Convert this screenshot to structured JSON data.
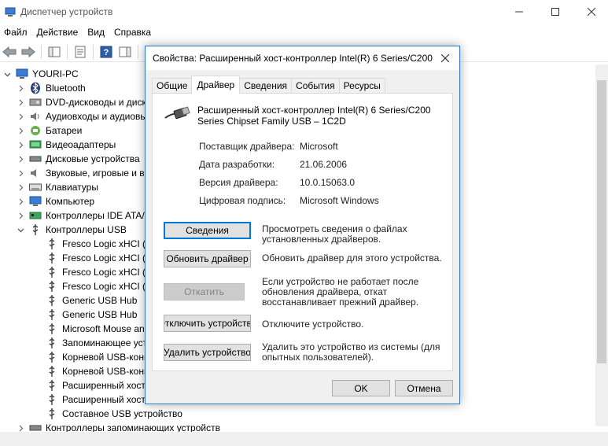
{
  "window": {
    "title": "Диспетчер устройств",
    "min_icon": "minimize-icon",
    "max_icon": "maximize-icon",
    "close_icon": "close-icon"
  },
  "menu": [
    "Файл",
    "Действие",
    "Вид",
    "Справка"
  ],
  "tree": {
    "root": "YOURI-PC",
    "items": [
      {
        "label": "Bluetooth",
        "icon": "bluetooth-icon",
        "expanded": false
      },
      {
        "label": "DVD-дисководы и диск",
        "icon": "dvd-drive-icon",
        "expanded": false
      },
      {
        "label": "Аудиовходы и аудиовь",
        "icon": "audio-icon",
        "expanded": false
      },
      {
        "label": "Батареи",
        "icon": "battery-icon",
        "expanded": false
      },
      {
        "label": "Видеоадаптеры",
        "icon": "display-adapter-icon",
        "expanded": false
      },
      {
        "label": "Дисковые устройства",
        "icon": "disk-drive-icon",
        "expanded": false
      },
      {
        "label": "Звуковые, игровые и в",
        "icon": "sound-icon",
        "expanded": false
      },
      {
        "label": "Клавиатуры",
        "icon": "keyboard-icon",
        "expanded": false
      },
      {
        "label": "Компьютер",
        "icon": "computer-icon",
        "expanded": false
      },
      {
        "label": "Контроллеры IDE ATA/",
        "icon": "ide-controller-icon",
        "expanded": false
      },
      {
        "label": "Контроллеры USB",
        "icon": "usb-icon",
        "expanded": true
      }
    ],
    "usb_children": [
      "Fresco Logic xHCI (U",
      "Fresco Logic xHCI (U",
      "Fresco Logic xHCI (U",
      "Fresco Logic xHCI (U",
      "Generic USB Hub",
      "Generic USB Hub",
      "Microsoft Mouse an",
      "Запоминающее уст",
      "Корневой USB-конц",
      "Корневой USB-конц",
      "Расширенный хост",
      "Расширенный хост",
      "Составное USB устройство"
    ],
    "last_item": "Контроллеры запоминающих устройств"
  },
  "dialog": {
    "title": "Свойства: Расширенный хост-контроллер Intel(R) 6 Series/C200",
    "tabs": [
      "Общие",
      "Драйвер",
      "Сведения",
      "События",
      "Ресурсы"
    ],
    "active_tab": 1,
    "device_name": "Расширенный хост-контроллер Intel(R) 6 Series/C200 Series Chipset Family USB – 1C2D",
    "props": [
      {
        "label": "Поставщик драйвера:",
        "value": "Microsoft"
      },
      {
        "label": "Дата разработки:",
        "value": "21.06.2006"
      },
      {
        "label": "Версия драйвера:",
        "value": "10.0.15063.0"
      },
      {
        "label": "Цифровая подпись:",
        "value": "Microsoft Windows"
      }
    ],
    "actions": [
      {
        "label": "Сведения",
        "desc": "Просмотреть сведения о файлах установленных драйверов.",
        "state": "focused"
      },
      {
        "label": "Обновить драйвер",
        "desc": "Обновить драйвер для этого устройства.",
        "state": "normal"
      },
      {
        "label": "Откатить",
        "desc": "Если устройство не работает после обновления драйвера, откат восстанавливает прежний драйвер.",
        "state": "disabled"
      },
      {
        "label": "Отключить устройство",
        "desc": "Отключите устройство.",
        "state": "normal"
      },
      {
        "label": "Удалить устройство",
        "desc": "Удалить это устройство из системы (для опытных пользователей).",
        "state": "normal"
      }
    ],
    "ok_label": "OK",
    "cancel_label": "Отмена"
  },
  "colors": {
    "accent": "#0078d7",
    "dialog_border": "#2b78c7",
    "button_face": "#e1e1e1",
    "disabled_text": "#838383"
  }
}
